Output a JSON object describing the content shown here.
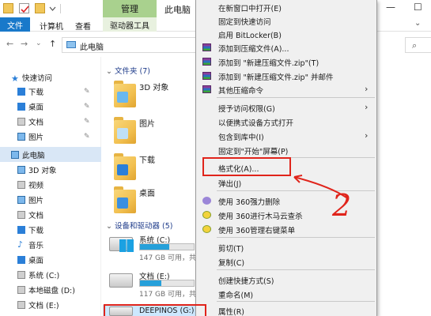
{
  "titlebar": {
    "manage_tab": "管理",
    "window_title": "此电脑",
    "minimize": "—",
    "maximize": "☐"
  },
  "ribbon": {
    "tabs": [
      "文件",
      "计算机",
      "查看"
    ],
    "drive_tools": "驱动器工具",
    "expand": "⌄"
  },
  "address": {
    "back": "←",
    "forward": "→",
    "history": "⌄",
    "up": "↑",
    "path": "此电脑",
    "search_icon": "⌕"
  },
  "nav": {
    "quick_access": "快速访问",
    "pin_icon": "✎",
    "quick_items": [
      "下载",
      "桌面",
      "文档",
      "图片"
    ],
    "this_pc": "此电脑",
    "pc_items": [
      "3D 对象",
      "视频",
      "图片",
      "文档",
      "下载",
      "音乐",
      "桌面",
      "系统 (C:)",
      "本地磁盘 (D:)",
      "文档 (E:)"
    ]
  },
  "content": {
    "folders_header": "文件夹 (7)",
    "folders": [
      "3D 对象",
      "图片",
      "下载",
      "桌面"
    ],
    "devices_header": "设备和驱动器 (5)",
    "drives": [
      {
        "name": "系统 (C:)",
        "free": "147 GB 可用，共",
        "used_fraction": 0.55
      },
      {
        "name": "文档 (E:)",
        "free": "117 GB 可用，共",
        "used_fraction": 0.4
      }
    ],
    "deepinos": "DEEPINOS (G:)"
  },
  "menu": {
    "items": [
      "在新窗口中打开(E)",
      "固定到快速访问",
      "启用 BitLocker(B)",
      "添加到压缩文件(A)...",
      "添加到 \"新建压缩文件.zip\"(T)",
      "添加到 \"新建压缩文件.zip\" 并邮件",
      "其他压缩命令",
      "授予访问权限(G)",
      "以便携式设备方式打开",
      "包含到库中(I)",
      "固定到\"开始\"屏幕(P)",
      "格式化(A)...",
      "弹出(J)",
      "使用 360强力删除",
      "使用 360进行木马云查杀",
      "使用 360管理右键菜单",
      "剪切(T)",
      "复制(C)",
      "创建快捷方式(S)",
      "重命名(M)",
      "属性(R)"
    ],
    "submenu_arrow": "›"
  },
  "annotation": {
    "number": "2",
    "color": "#e0241b"
  }
}
